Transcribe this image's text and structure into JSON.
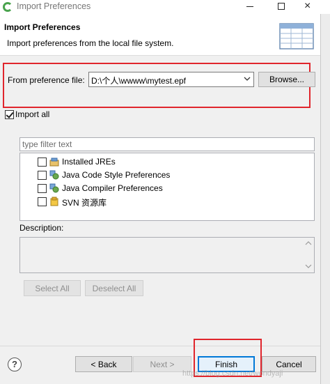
{
  "window": {
    "title": "Import Preferences",
    "close_glyph": "×"
  },
  "header": {
    "title": "Import Preferences",
    "description": "Import preferences from the local file system."
  },
  "file": {
    "label": "From preference file:",
    "value": "D:\\个人\\wwww\\mytest.epf",
    "browse_label": "Browse..."
  },
  "import_all": {
    "label": "Import all",
    "checked": true
  },
  "filter": {
    "placeholder": "type filter text"
  },
  "tree": {
    "items": [
      {
        "label": "Installed JREs",
        "icon": "jre-icon",
        "checked": false
      },
      {
        "label": "Java Code Style Preferences",
        "icon": "java-prefs-icon",
        "checked": false
      },
      {
        "label": "Java Compiler Preferences",
        "icon": "java-prefs-icon",
        "checked": false
      },
      {
        "label": "SVN 资源库",
        "icon": "svn-icon",
        "checked": false
      }
    ]
  },
  "description": {
    "label": "Description:"
  },
  "buttons": {
    "select_all": "Select All",
    "deselect_all": "Deselect All",
    "back": "< Back",
    "next": "Next >",
    "finish": "Finish",
    "cancel": "Cancel",
    "help": "?"
  },
  "watermark": "https://blog.csdn.net/wondyaji",
  "colors": {
    "highlight": "#e0252c",
    "default_button_border": "#0078d7"
  }
}
